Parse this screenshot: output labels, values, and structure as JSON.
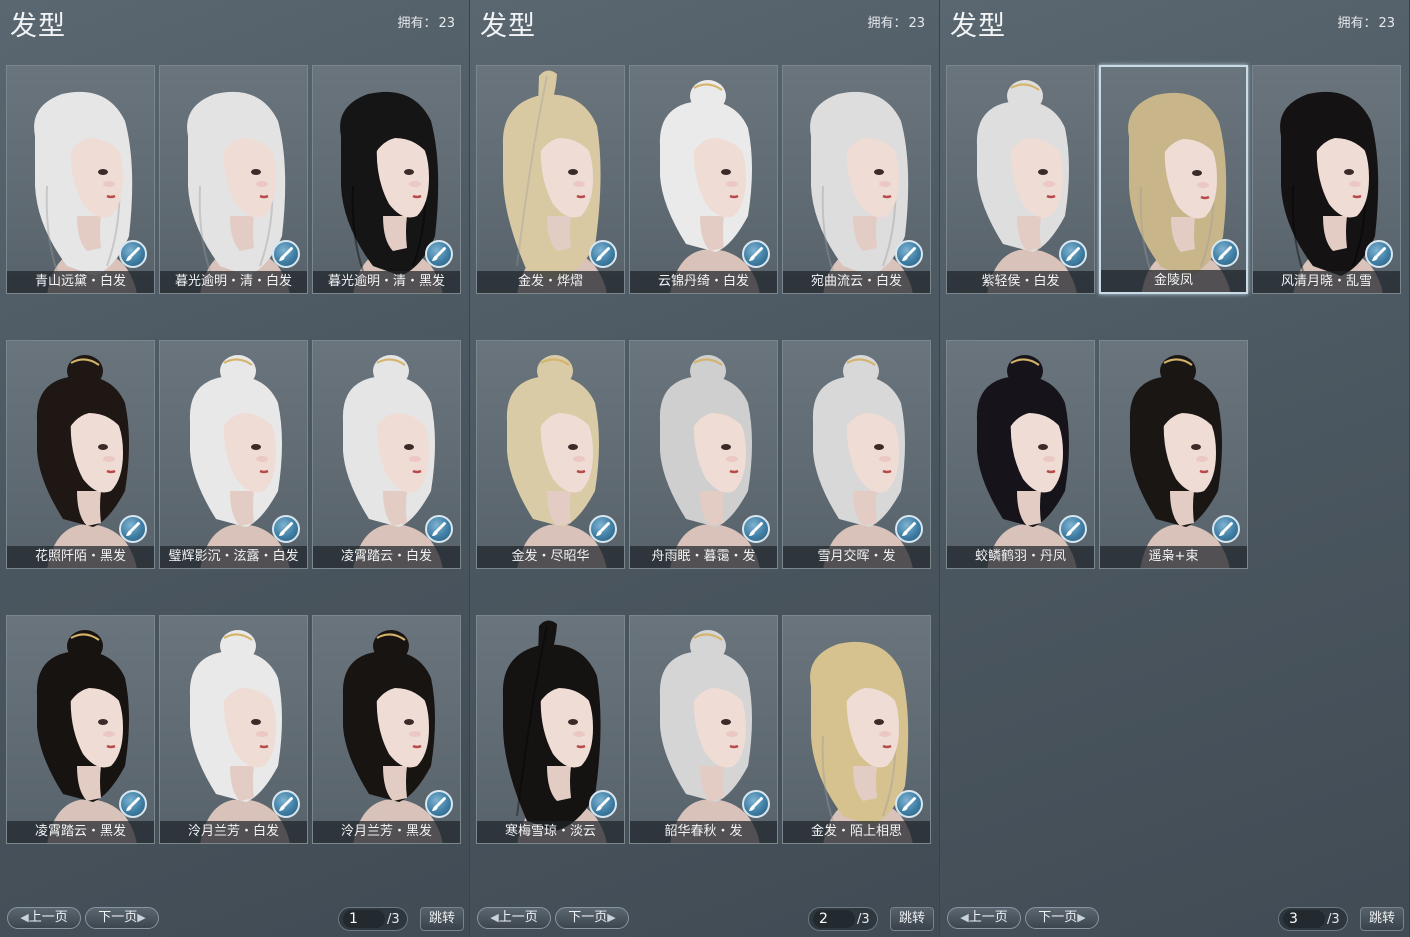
{
  "panels": [
    {
      "title": "发型",
      "owned_label": "拥有：",
      "owned_count": "23",
      "items": [
        {
          "label": "青山远黛・白发",
          "hair": "#e6e6e6",
          "style": "long"
        },
        {
          "label": "暮光逾明・清・白发",
          "hair": "#e3e3e3",
          "style": "long"
        },
        {
          "label": "暮光逾明・清・黑发",
          "hair": "#151515",
          "style": "long"
        },
        {
          "label": "花照阡陌・黑发",
          "hair": "#1e1714",
          "style": "bun"
        },
        {
          "label": "璧辉影沉・泫露・白发",
          "hair": "#e8e8e8",
          "style": "bun"
        },
        {
          "label": "凌霄踏云・白发",
          "hair": "#e5e5e5",
          "style": "bun"
        },
        {
          "label": "凌霄踏云・黑发",
          "hair": "#171311",
          "style": "bun"
        },
        {
          "label": "泠月兰芳・白发",
          "hair": "#e9e9e9",
          "style": "bun"
        },
        {
          "label": "泠月兰芳・黑发",
          "hair": "#181412",
          "style": "bun"
        }
      ],
      "pager": {
        "prev": "上一页",
        "next": "下一页",
        "current": "1",
        "total": "/3",
        "jump": "跳转"
      }
    },
    {
      "title": "发型",
      "owned_label": "拥有：",
      "owned_count": "23",
      "items": [
        {
          "label": "金发・烨熠",
          "hair": "#d8c9a3",
          "style": "pony"
        },
        {
          "label": "云锦丹绮・白发",
          "hair": "#eaeaea",
          "style": "bun"
        },
        {
          "label": "宛曲流云・白发",
          "hair": "#dddddd",
          "style": "long"
        },
        {
          "label": "金发・尽昭华",
          "hair": "#d9cba6",
          "style": "bun"
        },
        {
          "label": "舟雨眠・暮霭・发",
          "hair": "#cfcfcf",
          "style": "bun"
        },
        {
          "label": "雪月交晖・发",
          "hair": "#d8d8d8",
          "style": "bun"
        },
        {
          "label": "寒梅雪琼・淡云",
          "hair": "#151212",
          "style": "pony"
        },
        {
          "label": "韶华春秋・发",
          "hair": "#d5d5d5",
          "style": "bun"
        },
        {
          "label": "金发・陌上相思",
          "hair": "#d6c28f",
          "style": "long"
        }
      ],
      "pager": {
        "prev": "上一页",
        "next": "下一页",
        "current": "2",
        "total": "/3",
        "jump": "跳转"
      }
    },
    {
      "title": "发型",
      "owned_label": "拥有：",
      "owned_count": "23",
      "items": [
        {
          "label": "紫轻侯・白发",
          "hair": "#dedede",
          "style": "bun"
        },
        {
          "label": "金陵凤",
          "hair": "#c9b58a",
          "style": "long",
          "selected": true
        },
        {
          "label": "风清月晓・乱雪",
          "hair": "#141212",
          "style": "long"
        },
        {
          "label": "蛟鳞鹤羽・丹凤",
          "hair": "#16141a",
          "style": "bun"
        },
        {
          "label": "遥枭+束",
          "hair": "#1a1614",
          "style": "bun"
        }
      ],
      "pager": {
        "prev": "上一页",
        "next": "下一页",
        "current": "3",
        "total": "/3",
        "jump": "跳转"
      }
    }
  ],
  "icons": {
    "dye": "paintbrush-icon",
    "prev_arrow": "chevron-left-icon",
    "next_arrow": "chevron-right-icon"
  },
  "colors": {
    "background": "#4c5760",
    "card": "#636e76",
    "selected_border": "#c8dbe6",
    "dye_button": "#3f7ea4"
  }
}
